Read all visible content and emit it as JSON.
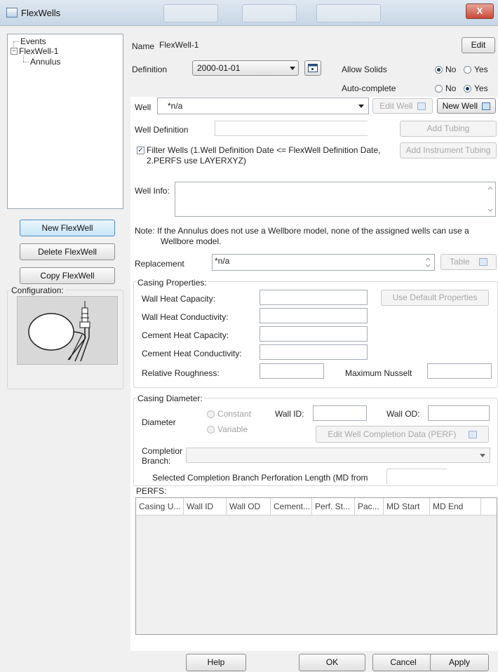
{
  "window": {
    "title": "FlexWells",
    "close_label": "X"
  },
  "tree": {
    "items": [
      {
        "label": "Events"
      },
      {
        "label": "FlexWell-1"
      },
      {
        "label": "Annulus"
      }
    ],
    "expander_symbol": "−"
  },
  "left_buttons": {
    "new": "New FlexWell",
    "delete": "Delete FlexWell",
    "copy": "Copy FlexWell"
  },
  "configuration": {
    "label": "Configuration:"
  },
  "header": {
    "name_label": "Name",
    "name_value": "FlexWell-1",
    "edit_label": "Edit",
    "definition_label": "Definition",
    "definition_value": "2000-01-01",
    "allow_solids_label": "Allow Solids",
    "allow_solids_no": "No",
    "allow_solids_yes": "Yes",
    "allow_solids_selected": "No",
    "auto_complete_label": "Auto-complete",
    "auto_complete_no": "No",
    "auto_complete_yes": "Yes",
    "auto_complete_selected": "Yes"
  },
  "well": {
    "label": "Well",
    "value": "*n/a",
    "edit_well": "Edit Well",
    "new_well": "New Well",
    "definition_label": "Well Definition",
    "definition_value": "",
    "add_tubing": "Add Tubing",
    "add_instrument_tubing": "Add Instrument Tubing",
    "filter_checked": true,
    "filter_text_line1": "Filter Wells (1.Well Definition Date <= FlexWell Definition Date,",
    "filter_text_line2": "2.PERFS use LAYERXYZ)",
    "info_label": "Well Info:",
    "info_value": ""
  },
  "note": {
    "line1": "Note: If the Annulus does not use a Wellbore model, none of the assigned wells can use a",
    "line2": "Wellbore model."
  },
  "replacement": {
    "label": "Replacement",
    "value": "*n/a",
    "table_label": "Table"
  },
  "casing_properties": {
    "legend": "Casing Properties:",
    "wall_heat_capacity": "Wall Heat Capacity:",
    "wall_heat_conductivity": "Wall Heat Conductivity:",
    "cement_heat_capacity": "Cement Heat Capacity:",
    "cement_heat_conductivity": "Cement Heat Conductivity:",
    "relative_roughness": "Relative Roughness:",
    "maximum_nusselt": "Maximum Nusselt",
    "use_default": "Use Default Properties"
  },
  "casing_diameter": {
    "legend": "Casing Diameter:",
    "diameter_label": "Diameter",
    "constant": "Constant",
    "variable": "Variable",
    "wall_id": "Wall ID:",
    "wall_od": "Wall OD:",
    "edit_completion": "Edit Well Completion Data (PERF)",
    "completion_branch_l1": "Completior",
    "completion_branch_l2": "Branch:",
    "selected_length": "Selected Completion Branch Perforation Length (MD from"
  },
  "perfs": {
    "legend": "PERFS:",
    "columns": [
      "Casing U...",
      "Wall ID",
      "Wall OD",
      "Cement...",
      "Perf. St...",
      "Pac...",
      "MD Start",
      "MD End"
    ]
  },
  "footer": {
    "help": "Help",
    "ok": "OK",
    "cancel": "Cancel",
    "apply": "Apply"
  }
}
